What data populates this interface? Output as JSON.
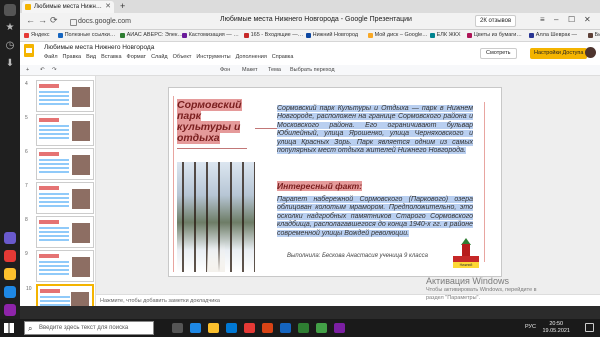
{
  "browser": {
    "tab_title": "Любимые места Нижн…",
    "tab_close": "✕",
    "new_tab": "+",
    "address": "docs.google.com",
    "page_title": "Любимые места Нижнего Новгорода - Google Презентации",
    "reviews": "2К отзывов",
    "nav": {
      "back": "←",
      "forward": "→",
      "reload": "⟳"
    },
    "window": {
      "menu": "≡",
      "minimize": "–",
      "maximize": "☐",
      "close": "✕"
    }
  },
  "bookmarks": [
    {
      "label": "Яндекс",
      "color": "#e53935"
    },
    {
      "label": "Полезные ссылки…",
      "color": "#1565c0"
    },
    {
      "label": "АИАС АВЕРС: Элек…",
      "color": "#2e7d32"
    },
    {
      "label": "Кастомизация — …",
      "color": "#6a1b9a"
    },
    {
      "label": "165 - Входящие —…",
      "color": "#c62828"
    },
    {
      "label": "Нижний Новгород",
      "color": "#0d47a1"
    },
    {
      "label": "Мой диск – Google…",
      "color": "#f9a825"
    },
    {
      "label": "ЕЛК ЖКХ",
      "color": "#00838f"
    },
    {
      "label": "Цветы из бумаги…",
      "color": "#ad1457"
    },
    {
      "label": "Алла Шеврак —",
      "color": "#283593"
    },
    {
      "label": "Биб",
      "color": "#5d4037"
    }
  ],
  "slides_app": {
    "doc_title": "Любимые места Нижнего Новгорода",
    "menu": [
      "Файл",
      "Правка",
      "Вид",
      "Вставка",
      "Формат",
      "Слайд",
      "Объект",
      "Инструменты",
      "Дополнения",
      "Справка"
    ],
    "present_label": "Смотреть",
    "access_label": "Настройки Доступа",
    "toolbar": [
      "+",
      "↶",
      "↷",
      "Фон",
      "Макет",
      "Тема",
      "Выбрать переход"
    ]
  },
  "slide": {
    "title_lines": [
      "Сормовский",
      "парк",
      "культуры и",
      "отдыха"
    ],
    "paragraph1": "Сормовский парк Культуры и Отдыха — парк в Нижнем Новгороде, расположен на границе Сормовского района и Московского района. Его ограничивают бульвар Юбилейный, улица Ярошенко, улица Черняховского и улица Красных Зорь. Парк является одним из самых популярных мест отдыха жителей Нижнего Новгорода.",
    "subheading": "Интересный факт:",
    "paragraph2": "Парапет набережной Сормовского (Паркового) озера облицован колотым мрамором. Предположительно, это осколки надгробных памятников Старого Сормовского кладбища, располагавшегося до конца 1940-х гг. в районе современной улицы Вождей революции.",
    "author": "Выполнила: Бескова Анастасия ученица 9 класса",
    "logo_caption": "Нижний"
  },
  "filmstrip": {
    "slide_numbers": [
      "4",
      "5",
      "6",
      "7",
      "8",
      "9",
      "10"
    ],
    "active_index": 6
  },
  "notes_placeholder": "Нажмите, чтобы добавить заметки докладчика",
  "watermark": {
    "title": "Активация Windows",
    "line1": "Чтобы активировать Windows, перейдите в",
    "line2": "раздел \"Параметры\"."
  },
  "taskbar": {
    "search_placeholder": "Введите здесь текст для поиска",
    "lang": "РУС",
    "time": "20:50",
    "date": "19.05.2021"
  },
  "sidebar": {
    "favorites_icon": "★",
    "history_icon": "◷",
    "downloads_icon": "⬇"
  }
}
